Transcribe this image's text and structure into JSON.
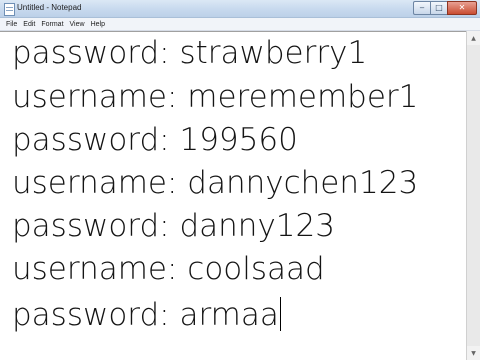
{
  "window": {
    "title": "Untitled - Notepad",
    "controls": {
      "minimize_glyph": "‒",
      "maximize_glyph": "□",
      "close_glyph": "✕"
    }
  },
  "menu": {
    "items": [
      "File",
      "Edit",
      "Format",
      "View",
      "Help"
    ]
  },
  "editor": {
    "lines": [
      "password: strawberry1",
      "username: meremember1",
      "password: 199560",
      "username: dannychen123",
      "password: danny123",
      "username: coolsaad",
      "password: armaa"
    ]
  },
  "scrollbar": {
    "up_glyph": "▲",
    "down_glyph": "▼"
  },
  "icons": {
    "app": "notepad-icon",
    "caret": "text-caret"
  }
}
